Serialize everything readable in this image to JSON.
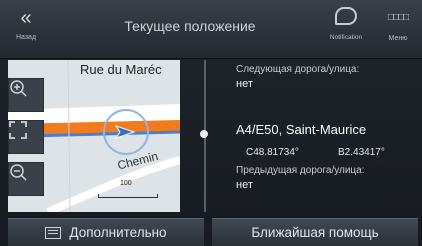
{
  "topbar": {
    "back_icon": "«",
    "back_label": "Назад",
    "title": "Текущее положение",
    "notification_label": "Notification",
    "menu_icon": "□□□□",
    "menu_label": "Меню"
  },
  "map": {
    "street_top": "Rue du Maréc",
    "street_bottom": "Chemin",
    "scale_label": "100"
  },
  "info": {
    "next_road_label": "Следующая дорога/улица:",
    "next_road_value": "нет",
    "current_road": "A4/E50, Saint-Maurice",
    "latitude": "C48.81734°",
    "longitude": "B2.43417°",
    "prev_road_label": "Предыдущая дорога/улица:",
    "prev_road_value": "нет"
  },
  "bottom": {
    "more_label": "Дополнительно",
    "help_label": "Ближайшая помощь"
  },
  "colors": {
    "route": "#f07c1b",
    "route_blue": "#4a7fcf",
    "position_arrow": "#2f6fd6"
  }
}
